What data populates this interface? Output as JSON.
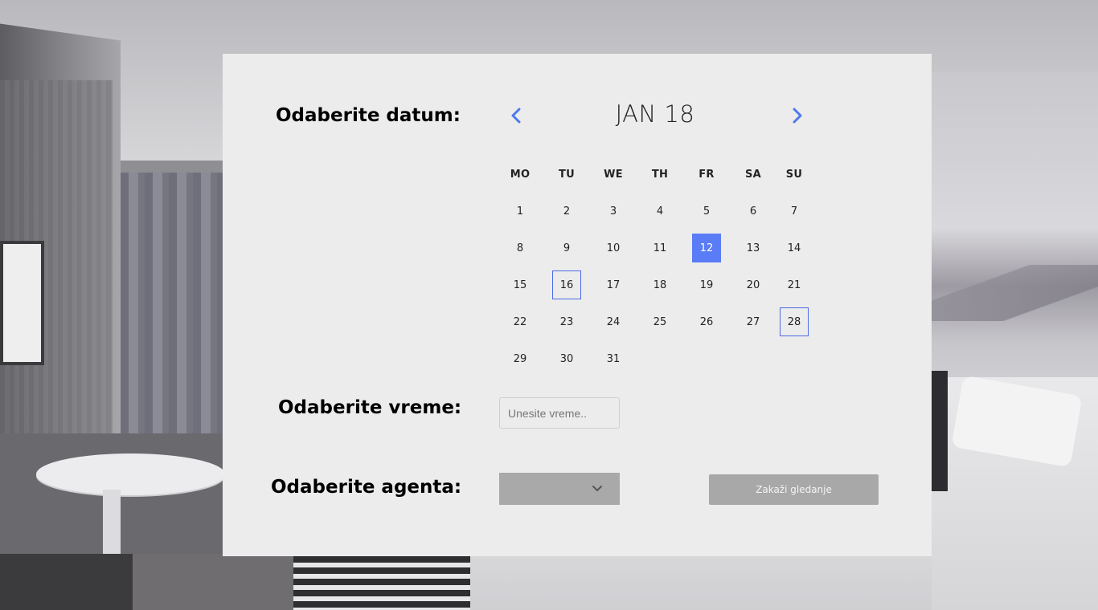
{
  "labels": {
    "date": "Odaberite datum:",
    "time": "Odaberite vreme:",
    "agent": "Odaberite agenta:"
  },
  "calendar": {
    "month_title": "JAN 18",
    "weekdays": [
      "MO",
      "TU",
      "WE",
      "TH",
      "FR",
      "SA",
      "SU"
    ],
    "days": [
      "1",
      "2",
      "3",
      "4",
      "5",
      "6",
      "7",
      "8",
      "9",
      "10",
      "11",
      "12",
      "13",
      "14",
      "15",
      "16",
      "17",
      "18",
      "19",
      "20",
      "21",
      "22",
      "23",
      "24",
      "25",
      "26",
      "27",
      "28",
      "29",
      "30",
      "31"
    ],
    "selected_day": "12",
    "marked_days": [
      "16",
      "28"
    ]
  },
  "time_input": {
    "placeholder": "Unesite vreme..",
    "value": ""
  },
  "agent_select": {
    "value": ""
  },
  "submit_button": {
    "label": "Zakaži gledanje"
  },
  "icons": {
    "prev": "chevron-left-icon",
    "next": "chevron-right-icon",
    "dropdown": "chevron-down-icon"
  },
  "colors": {
    "accent": "#5a7cf6",
    "panel": "#ececec",
    "button": "#a8a8a8"
  }
}
